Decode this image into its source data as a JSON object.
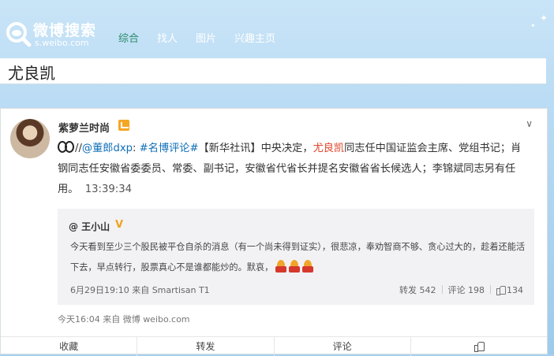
{
  "header": {
    "logo_title": "微博搜索",
    "logo_url": "s.weibo.com",
    "nav": [
      "综合",
      "找人",
      "图片",
      "兴趣主页"
    ]
  },
  "search": {
    "query": "尤良凯"
  },
  "post": {
    "username": "紫萝兰时尚",
    "sep": "//",
    "mention": "@董郎dxp",
    "colon": ": ",
    "hashtag": "#名博评论#",
    "text_a": "【新华社讯】中央决定，",
    "highlight": "尤良凯",
    "text_b": "同志任中国证监会主席、党组书记；肖钢同志任安徽省委委员、常委、副书记，安徽省代省长并提名安徽省省长候选人；李锦斌同志另有任用。",
    "time": "13:39:34",
    "repost": {
      "user": "@ 王小山",
      "verified": "V",
      "text": "今天看到至少三个股民被平仓自杀的消息（有一个尚未得到证实），很悲凉，奉劝智商不够、贪心过大的，趁着还能活下去，早点转行，股票真心不是谁都能炒的。默哀，",
      "meta": "6月29日19:10 来自 Smartisan T1",
      "repost_label": "转发 542",
      "comment_label": "评论 198",
      "like_count": "134"
    },
    "meta": "今天16:04 来自 微博 weibo.com"
  },
  "actions": {
    "collect": "收藏",
    "forward": "转发",
    "comment": "评论"
  },
  "colors": {
    "link": "#0e6fb8",
    "highlight": "#e0452b",
    "nav_active": "#2a8a6a"
  }
}
